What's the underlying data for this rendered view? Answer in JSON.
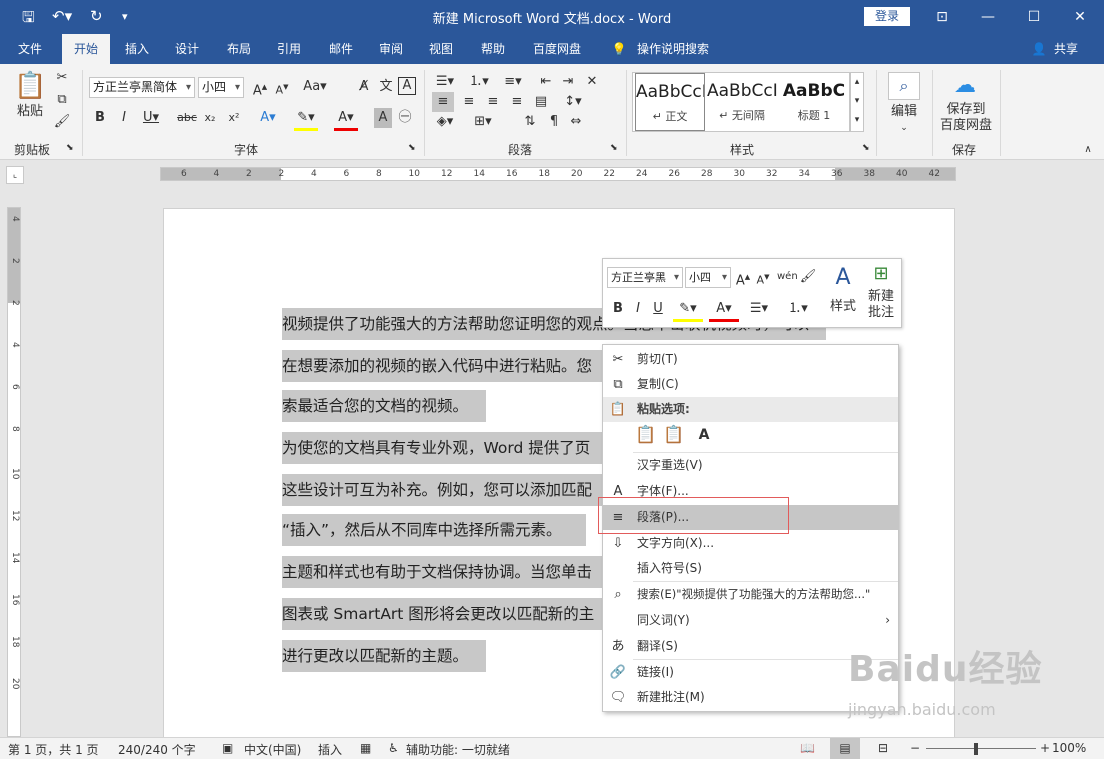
{
  "window": {
    "title": "新建 Microsoft Word 文档.docx  -  Word",
    "login": "登录",
    "share": "共享"
  },
  "tabs": [
    "文件",
    "开始",
    "插入",
    "设计",
    "布局",
    "引用",
    "邮件",
    "审阅",
    "视图",
    "帮助",
    "百度网盘",
    "操作说明搜索"
  ],
  "ribbon": {
    "clipboard": {
      "paste": "粘贴",
      "label": "剪贴板"
    },
    "font": {
      "family": "方正兰亭黑简体",
      "size": "小四",
      "label": "字体"
    },
    "paragraph": {
      "label": "段落"
    },
    "styles": {
      "label": "样式",
      "items": [
        {
          "sample": "AaBbCcI",
          "name": "↵ 正文"
        },
        {
          "sample": "AaBbCcI",
          "name": "↵ 无间隔"
        },
        {
          "sample": "AaBbC",
          "name": "标题 1"
        }
      ]
    },
    "edit": {
      "label": "编辑"
    },
    "save": {
      "label1": "保存到",
      "label2": "百度网盘",
      "group": "保存"
    }
  },
  "ruler": {
    "h_labels": [
      "6",
      "4",
      "2",
      "2",
      "4",
      "6",
      "8",
      "10",
      "12",
      "14",
      "16",
      "18",
      "20",
      "22",
      "24",
      "26",
      "28",
      "30",
      "32",
      "34",
      "36",
      "38",
      "40",
      "42"
    ],
    "v_labels": [
      "4",
      "2",
      "2",
      "4",
      "6",
      "8",
      "10",
      "12",
      "14",
      "16",
      "18",
      "20"
    ]
  },
  "document": {
    "lines": [
      "视频提供了功能强大的方法帮助您证明您的观点。当您单击联机视频时，可以",
      "在想要添加的视频的嵌入代码中进行粘贴。您",
      "索最适合您的文档的视频。",
      "为使您的文档具有专业外观，Word 提供了页",
      "这些设计可互为补充。例如，您可以添加匹配",
      "“插入”，然后从不同库中选择所需元素。",
      "主题和样式也有助于文档保持协调。当您单击",
      "图表或 SmartArt 图形将会更改以匹配新的主",
      "进行更改以匹配新的主题。"
    ]
  },
  "mini_toolbar": {
    "font": "方正兰亭黑",
    "size": "小四",
    "styles": "样式",
    "new_comment1": "新建",
    "new_comment2": "批注"
  },
  "context_menu": {
    "items": [
      {
        "label": "剪切(T)",
        "icon": "scissors-icon"
      },
      {
        "label": "复制(C)",
        "icon": "copy-icon"
      },
      {
        "label": "粘贴选项:",
        "icon": "paste-icon"
      },
      {
        "label": "汉字重选(V)",
        "icon": ""
      },
      {
        "label": "字体(F)...",
        "icon": "font-icon"
      },
      {
        "label": "段落(P)...",
        "icon": "paragraph-icon"
      },
      {
        "label": "文字方向(X)...",
        "icon": "text-direction-icon"
      },
      {
        "label": "插入符号(S)",
        "icon": ""
      },
      {
        "label": "搜索(E)\"视频提供了功能强大的方法帮助您...\"",
        "icon": "search-icon"
      },
      {
        "label": "同义词(Y)",
        "icon": ""
      },
      {
        "label": "翻译(S)",
        "icon": "translate-icon"
      },
      {
        "label": "链接(I)",
        "icon": "link-icon"
      },
      {
        "label": "新建批注(M)",
        "icon": "comment-icon"
      }
    ]
  },
  "status": {
    "page": "第 1 页，共 1 页",
    "words": "240/240 个字",
    "lang": "中文(中国)",
    "mode": "插入",
    "accessibility": "辅助功能: 一切就绪",
    "zoom": "100%"
  },
  "watermark": {
    "brand": "Baidu经验",
    "url": "jingyan.baidu.com"
  },
  "colors": {
    "brand": "#2b579a",
    "highlight": "#c6c6c6",
    "red_box": "#e25b5b"
  }
}
